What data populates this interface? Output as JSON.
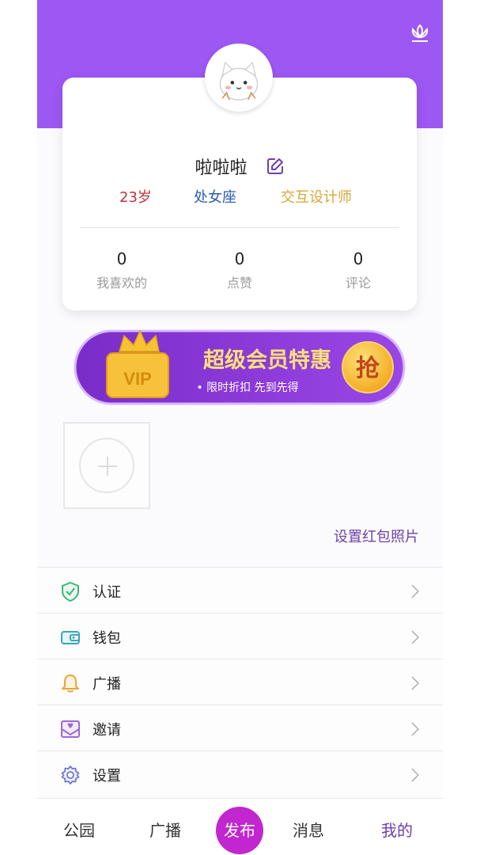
{
  "profile": {
    "username": "啦啦啦",
    "tags": {
      "age": "23岁",
      "zodiac": "处女座",
      "occupation": "交互设计师"
    },
    "stats": [
      {
        "value": "0",
        "label": "我喜欢的"
      },
      {
        "value": "0",
        "label": "点赞"
      },
      {
        "value": "0",
        "label": "评论"
      }
    ]
  },
  "vip_banner": {
    "title": "超级会员特惠",
    "subtitle": "• 限时折扣  先到先得",
    "grab_label": "抢",
    "badge": "VIP"
  },
  "photo": {
    "set_red_packet_label": "设置红包照片"
  },
  "menu": [
    {
      "label": "认证",
      "icon": "shield-check-icon"
    },
    {
      "label": "钱包",
      "icon": "wallet-icon"
    },
    {
      "label": "广播",
      "icon": "bell-icon"
    },
    {
      "label": "邀请",
      "icon": "invite-mail-icon"
    },
    {
      "label": "设置",
      "icon": "gear-icon"
    }
  ],
  "tabbar": {
    "park": "公园",
    "broadcast": "广播",
    "publish": "发布",
    "messages": "消息",
    "mine": "我的"
  },
  "colors": {
    "header_purple": "#9d57f3",
    "active_tab": "#6e3fa8",
    "publish_button": "#c126cf",
    "age_tag": "#c0333d",
    "zodiac_tag": "#2a5ab5",
    "occupation_tag": "#d8a636"
  }
}
